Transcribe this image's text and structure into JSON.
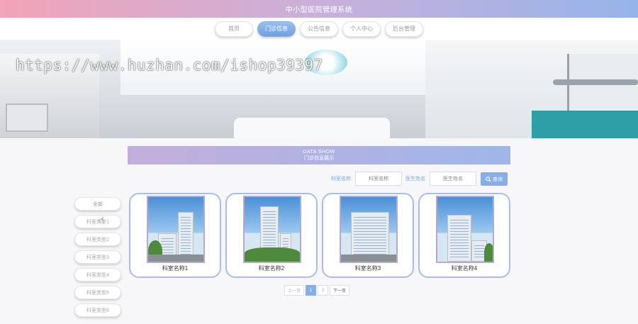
{
  "header": {
    "title": "中小型医院管理系统"
  },
  "nav": {
    "items": [
      "首页",
      "门诊信息",
      "公告信息",
      "个人中心",
      "后台管理"
    ],
    "active_index": 1
  },
  "banner": {
    "watermark": "https://www.huzhan.com/ishop39397"
  },
  "section": {
    "title_en": "DATA SHOW",
    "title_cn": "门诊信息展示"
  },
  "search": {
    "dept_label": "科室名称",
    "dept_placeholder": "科室名称",
    "doctor_label": "医生姓名",
    "doctor_placeholder": "医生姓名",
    "button_label": "查询"
  },
  "sidebar": {
    "items": [
      "全部",
      "科室类型1",
      "科室类型2",
      "科室类型3",
      "科室类型4",
      "科室类型5",
      "科室类型6"
    ]
  },
  "cards": [
    {
      "name": "科室名称1"
    },
    {
      "name": "科室名称2"
    },
    {
      "name": "科室名称3"
    },
    {
      "name": "科室名称4"
    }
  ],
  "pager": {
    "prev": "上一页",
    "pages": [
      "1",
      "2"
    ],
    "active": "1",
    "next": "下一页"
  },
  "icons": {
    "search": "search-icon",
    "cursor": "hand-pointer-icon"
  },
  "colors": {
    "accent": "#86aee9",
    "header_start": "#f2a4b8",
    "header_end": "#96b4ea",
    "card_border": "#a9bdea"
  }
}
